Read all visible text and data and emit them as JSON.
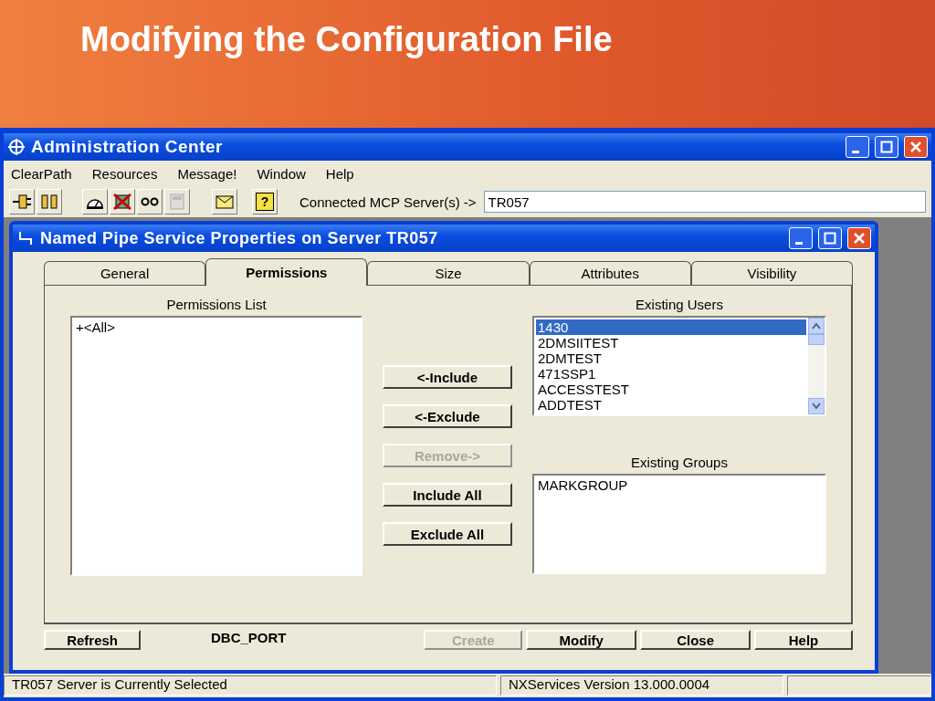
{
  "slide": {
    "title": "Modifying the Configuration File"
  },
  "window": {
    "title": "Administration Center"
  },
  "menu": [
    {
      "label": "ClearPath"
    },
    {
      "label": "Resources"
    },
    {
      "label": "Message!"
    },
    {
      "label": "Window"
    },
    {
      "label": "Help"
    }
  ],
  "toolbar": [
    {
      "kind": "plug",
      "disabled": false
    },
    {
      "kind": "socket",
      "disabled": false
    },
    {
      "kind": "gauge",
      "disabled": false
    },
    {
      "kind": "cross",
      "disabled": false
    },
    {
      "kind": "glasses",
      "disabled": false
    },
    {
      "kind": "calc",
      "disabled": true
    },
    {
      "kind": "envelope",
      "disabled": false
    },
    {
      "kind": "question",
      "disabled": false,
      "glyph": "?"
    }
  ],
  "server_field": {
    "label": "Connected MCP Server(s) ->",
    "value": "TR057"
  },
  "dialog": {
    "title": "Named Pipe Service Properties on Server TR057",
    "tabs": [
      {
        "label": "General",
        "selected": false
      },
      {
        "label": "Permissions",
        "selected": true
      },
      {
        "label": "Size",
        "selected": false
      },
      {
        "label": "Attributes",
        "selected": false
      },
      {
        "label": "Visibility",
        "selected": false
      }
    ],
    "permissions_list": {
      "label": "Permissions List",
      "items": [
        {
          "text": "+<All>",
          "selected": false
        }
      ]
    },
    "actions": [
      {
        "label": "<-Include",
        "disabled": false
      },
      {
        "label": "<-Exclude",
        "disabled": false
      },
      {
        "label": "Remove->",
        "disabled": true
      },
      {
        "label": "Include All",
        "disabled": false
      },
      {
        "label": "Exclude All",
        "disabled": false
      }
    ],
    "existing_users": {
      "label": "Existing Users",
      "items": [
        {
          "text": "1430",
          "selected": true
        },
        {
          "text": "2DMSIITEST",
          "selected": false
        },
        {
          "text": "2DMTEST",
          "selected": false
        },
        {
          "text": "471SSP1",
          "selected": false
        },
        {
          "text": "ACCESSTEST",
          "selected": false
        },
        {
          "text": "ADDTEST",
          "selected": false
        }
      ]
    },
    "existing_groups": {
      "label": "Existing Groups",
      "items": [
        {
          "text": "MARKGROUP",
          "selected": false
        }
      ]
    },
    "footer": [
      {
        "kind": "button",
        "label": "Refresh",
        "disabled": false
      },
      {
        "kind": "label",
        "label": "DBC_PORT"
      },
      {
        "kind": "button",
        "label": "Create",
        "disabled": true
      },
      {
        "kind": "button",
        "label": "Modify",
        "disabled": false
      },
      {
        "kind": "button",
        "label": "Close",
        "disabled": false
      },
      {
        "kind": "button",
        "label": "Help",
        "disabled": false
      }
    ]
  },
  "status_bar": [
    "TR057 Server is Currently Selected",
    "NXServices Version 13.000.0004"
  ]
}
